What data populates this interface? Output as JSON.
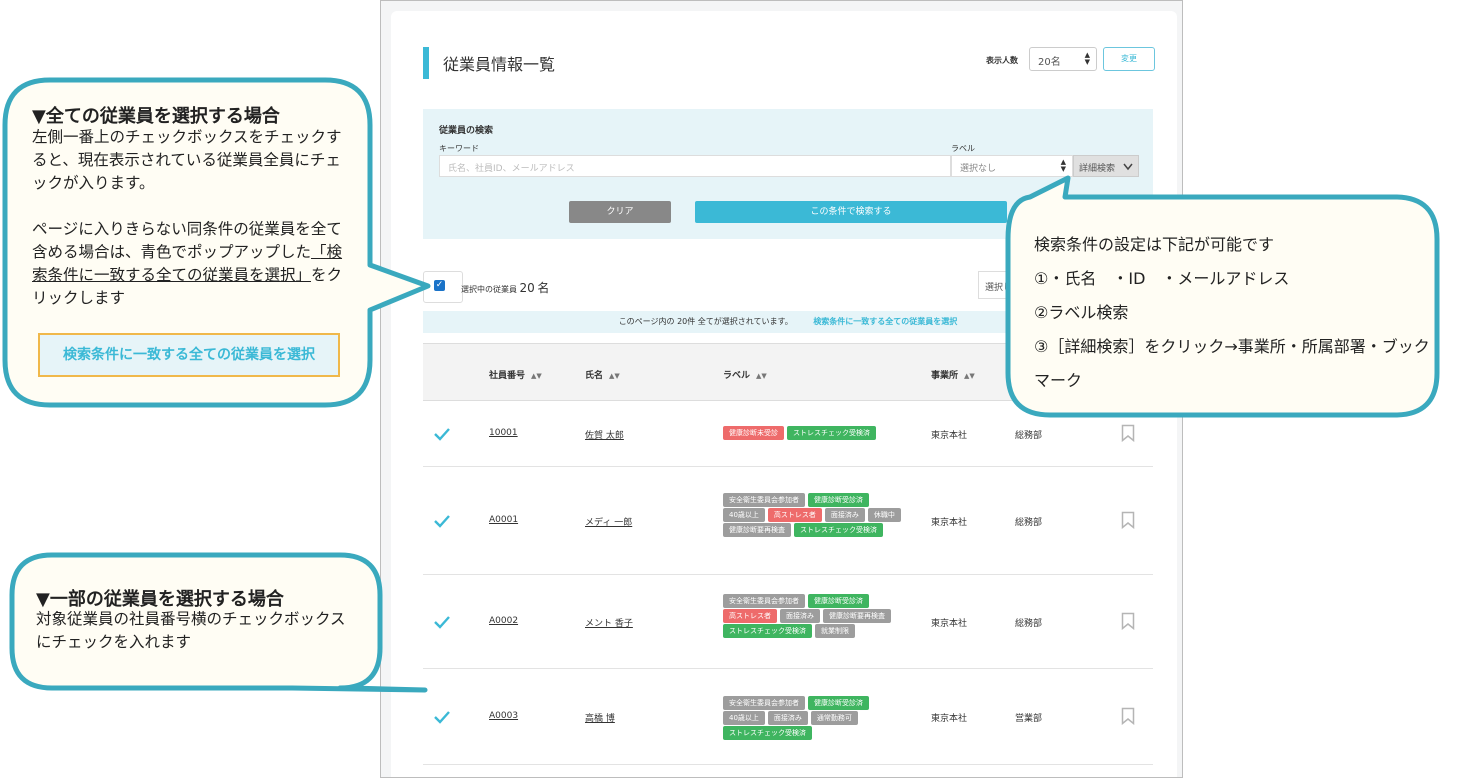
{
  "header": {
    "title": "従業員情報一覧",
    "display_label": "表示人数",
    "display_value": "20名",
    "change_button": "変更"
  },
  "search": {
    "title": "従業員の検索",
    "keyword_label": "キーワード",
    "keyword_placeholder": "氏名、社員ID、メールアドレス",
    "label_label": "ラベル",
    "label_value": "選択なし",
    "detail_button": "詳細検索",
    "clear_button": "クリア",
    "search_button": "この条件で検索する"
  },
  "selection": {
    "count_prefix": "選択中の従業員",
    "count": "20",
    "count_suffix": "名",
    "action_button": "選択し",
    "notice": "このページ内の 20件 全てが選択されています。",
    "select_all_link": "検索条件に一致する全ての従業員を選択"
  },
  "table": {
    "headers": {
      "id": "社員番号",
      "name": "氏名",
      "label": "ラベル",
      "office": "事業所"
    },
    "sort_glyph": "▲▼",
    "rows": [
      {
        "id": "10001",
        "name": "佐賀 太郎",
        "office": "東京本社",
        "dept": "総務部",
        "labels": [
          {
            "text": "健康診断未受診",
            "color": "red"
          },
          {
            "text": "ストレスチェック受検済",
            "color": "green"
          }
        ]
      },
      {
        "id": "A0001",
        "name": "メディ 一郎",
        "office": "東京本社",
        "dept": "総務部",
        "labels": [
          {
            "text": "安全衛生委員会参加者",
            "color": "gray"
          },
          {
            "text": "健康診断受診済",
            "color": "green"
          },
          {
            "text": "40歳以上",
            "color": "gray"
          },
          {
            "text": "高ストレス者",
            "color": "red"
          },
          {
            "text": "面接済み",
            "color": "gray"
          },
          {
            "text": "休職中",
            "color": "gray"
          },
          {
            "text": "健康診断要再検査",
            "color": "gray"
          },
          {
            "text": "ストレスチェック受検済",
            "color": "green"
          }
        ]
      },
      {
        "id": "A0002",
        "name": "メント 香子",
        "office": "東京本社",
        "dept": "総務部",
        "labels": [
          {
            "text": "安全衛生委員会参加者",
            "color": "gray"
          },
          {
            "text": "健康診断受診済",
            "color": "green"
          },
          {
            "text": "高ストレス者",
            "color": "red"
          },
          {
            "text": "面接済み",
            "color": "gray"
          },
          {
            "text": "健康診断要再検査",
            "color": "gray"
          },
          {
            "text": "ストレスチェック受検済",
            "color": "green"
          },
          {
            "text": "就業制限",
            "color": "gray"
          }
        ]
      },
      {
        "id": "A0003",
        "name": "高橋 博",
        "office": "東京本社",
        "dept": "営業部",
        "labels": [
          {
            "text": "安全衛生委員会参加者",
            "color": "gray"
          },
          {
            "text": "健康診断受診済",
            "color": "green"
          },
          {
            "text": "40歳以上",
            "color": "gray"
          },
          {
            "text": "面接済み",
            "color": "gray"
          },
          {
            "text": "通常勤務可",
            "color": "gray"
          },
          {
            "text": "ストレスチェック受検済",
            "color": "green"
          }
        ]
      }
    ]
  },
  "callouts": {
    "select_all": {
      "title": "▼全ての従業員を選択する場合",
      "body1": "左側一番上のチェックボックスをチェックすると、現在表示されている従業員全員にチェックが入ります。",
      "body2_pre": "ページに入りきらない同条件の従業員を全て含める場合は、青色でポップアップした",
      "body2_link": "「検索条件に一致する全ての従業員を選択」",
      "body2_post": "をクリックします",
      "button": "検索条件に一致する全ての従業員を選択"
    },
    "search_conditions": {
      "lines": [
        "検索条件の設定は下記が可能です",
        "①・氏名　・ID　・メールアドレス",
        "②ラベル検索",
        "③［詳細検索］をクリック→事業所・所属部署・ブックマーク"
      ]
    },
    "select_some": {
      "title": "▼一部の従業員を選択する場合",
      "body": "対象従業員の社員番号横のチェックボックスにチェックを入れます"
    }
  },
  "colors": {
    "accent": "#3bb9d6",
    "tag_green": "#3fb560",
    "tag_red": "#ee6b6b",
    "tag_gray": "#9d9d9d",
    "callout_border": "#3aa9be",
    "callout_fill": "#fffdf4"
  }
}
